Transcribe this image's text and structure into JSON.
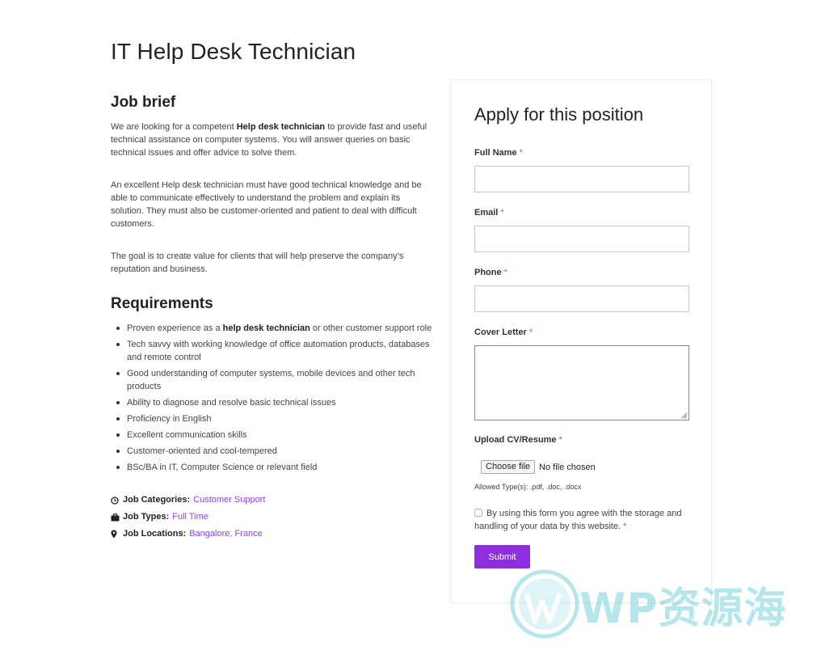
{
  "page": {
    "title": "IT Help Desk Technician"
  },
  "job_brief": {
    "heading": "Job brief",
    "p1_pre": "We are looking for a competent ",
    "p1_bold": "Help desk technician",
    "p1_post": " to provide fast and useful technical assistance on computer systems. You will answer queries on basic technical issues and offer advice to solve them.",
    "p2": "An excellent Help desk technician must have good technical knowledge and be able to communicate effectively to understand the problem and explain its solution. They must also be customer-oriented and patient to deal with difficult customers.",
    "p3": "The goal is to create value for clients that will help preserve the company’s reputation and business."
  },
  "requirements": {
    "heading": "Requirements",
    "item0_pre": "Proven experience as a ",
    "item0_bold": "help desk technician",
    "item0_post": " or other customer support role",
    "items": [
      "Tech savvy with working knowledge of office automation products, databases and remote control",
      "Good understanding of computer systems, mobile devices and other tech products",
      "Ability to diagnose and resolve basic technical issues",
      "Proficiency in English",
      "Excellent communication skills",
      "Customer-oriented and cool-tempered",
      "BSc/BA in IT, Computer Science or relevant field"
    ]
  },
  "meta": {
    "categories_label": "Job Categories:",
    "categories_value": "Customer Support",
    "types_label": "Job Types:",
    "types_value": "Full Time",
    "locations_label": "Job Locations:",
    "locations_value": "Bangalore, France",
    "icons": [
      "clock-icon",
      "briefcase-icon",
      "map-pin-icon"
    ],
    "link_color": "#8e44e0"
  },
  "form": {
    "title": "Apply for this position",
    "full_name_label": "Full Name",
    "email_label": "Email",
    "phone_label": "Phone",
    "cover_letter_label": "Cover Letter",
    "upload_label": "Upload CV/Resume",
    "required_marker": "*",
    "choose_file": "Choose file",
    "no_file": "No file chosen",
    "allowed_types": "Allowed Type(s): .pdf, .doc, .docx",
    "consent_text": "By using this form you agree with the storage and handling of your data by this website.",
    "submit_label": "Submit",
    "submit_color": "#8e2ee0"
  },
  "watermark": {
    "text": "WP资源海"
  }
}
